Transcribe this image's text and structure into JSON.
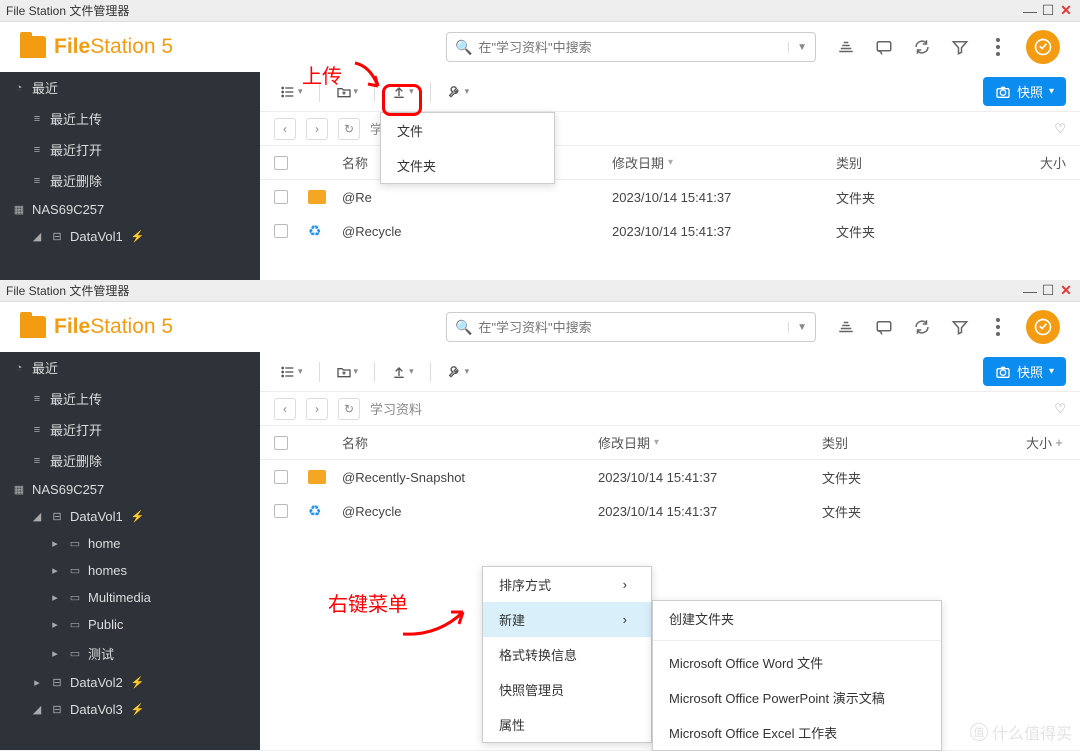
{
  "titlebar": "File Station 文件管理器",
  "app": {
    "name_bold": "File",
    "name_thin": "Station 5"
  },
  "search": {
    "placeholder": "在\"学习资料\"中搜索"
  },
  "snapshot_btn": "快照",
  "sidebar": {
    "recent": "最近",
    "recent_upload": "最近上传",
    "recent_open": "最近打开",
    "recent_delete": "最近删除",
    "nas": "NAS69C257",
    "vol1": "DataVol1",
    "vol2": "DataVol2",
    "vol3": "DataVol3",
    "home": "home",
    "homes": "homes",
    "multimedia": "Multimedia",
    "public": "Public",
    "test": "测试"
  },
  "crumb": {
    "path_short": "学",
    "path": "学习资料"
  },
  "thead": {
    "name": "名称",
    "date": "修改日期",
    "type": "类别",
    "size": "大小"
  },
  "rows": [
    {
      "name": "@Recently-Snapshot",
      "name_short": "@Re",
      "date": "2023/10/14 15:41:37",
      "type": "文件夹"
    },
    {
      "name": "@Recycle",
      "date": "2023/10/14 15:41:37",
      "type": "文件夹"
    }
  ],
  "upload_menu": {
    "file": "文件",
    "folder": "文件夹"
  },
  "ctx_menu": {
    "sort": "排序方式",
    "new": "新建",
    "convert": "格式转换信息",
    "snapshot_mgr": "快照管理员",
    "props": "属性"
  },
  "new_submenu": {
    "folder": "创建文件夹",
    "word": "Microsoft Office Word 文件",
    "ppt": "Microsoft Office PowerPoint 演示文稿",
    "excel": "Microsoft Office Excel 工作表"
  },
  "anno": {
    "upload": "上传",
    "rightclick": "右键菜单"
  }
}
